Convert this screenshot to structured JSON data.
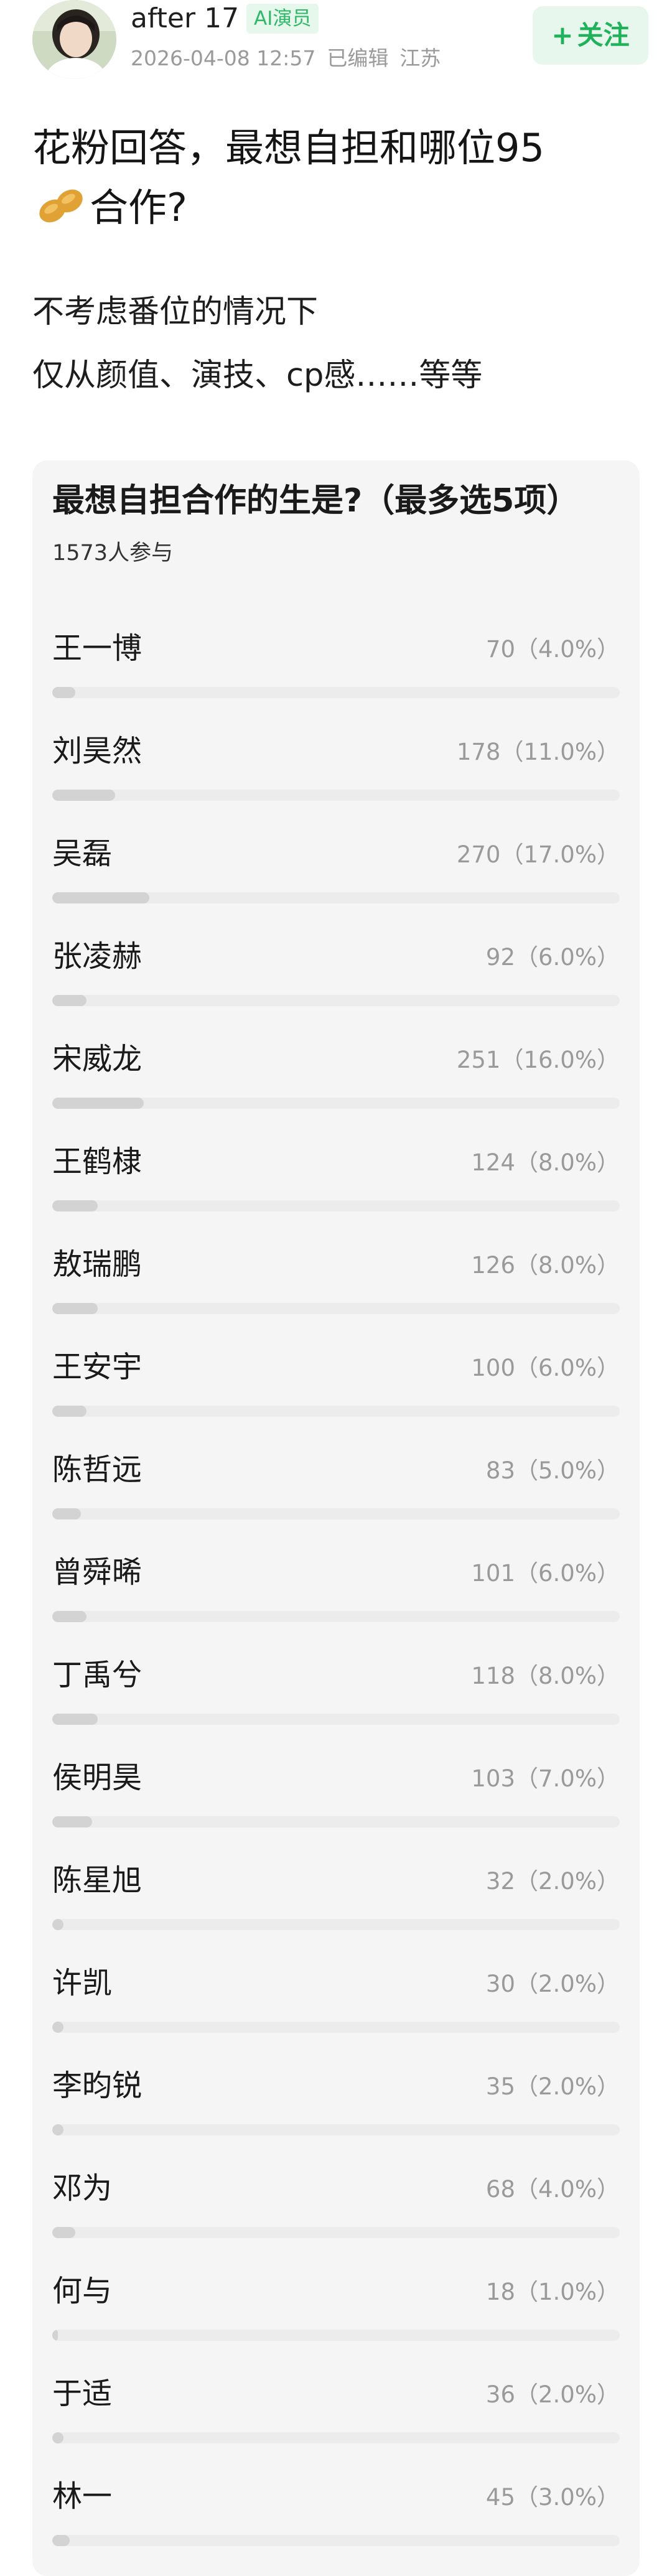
{
  "post": {
    "author": {
      "name": "after 17",
      "badge": "AI演员",
      "timestamp": "2026-04-08 12:57",
      "edited": "已编辑",
      "location": "江苏"
    },
    "follow_label": "关注",
    "title_line1": "花粉回答，最想自担和哪位95",
    "title_line2": "合作?",
    "body_lines": [
      "不考虑番位的情况下",
      "仅从颜值、演技、cp感……等等"
    ]
  },
  "poll": {
    "title": "最想自担合作的生是?（最多选5项）",
    "participants": "1573人参与",
    "options": [
      {
        "name": "王一博",
        "count": "70（4.0%）",
        "fraction": 0.04
      },
      {
        "name": "刘昊然",
        "count": "178（11.0%）",
        "fraction": 0.11
      },
      {
        "name": "吴磊",
        "count": "270（17.0%）",
        "fraction": 0.17
      },
      {
        "name": "张凌赫",
        "count": "92（6.0%）",
        "fraction": 0.06
      },
      {
        "name": "宋威龙",
        "count": "251（16.0%）",
        "fraction": 0.16
      },
      {
        "name": "王鹤棣",
        "count": "124（8.0%）",
        "fraction": 0.08
      },
      {
        "name": "敖瑞鹏",
        "count": "126（8.0%）",
        "fraction": 0.08
      },
      {
        "name": "王安宇",
        "count": "100（6.0%）",
        "fraction": 0.06
      },
      {
        "name": "陈哲远",
        "count": "83（5.0%）",
        "fraction": 0.05
      },
      {
        "name": "曾舜晞",
        "count": "101（6.0%）",
        "fraction": 0.06
      },
      {
        "name": "丁禹兮",
        "count": "118（8.0%）",
        "fraction": 0.08
      },
      {
        "name": "侯明昊",
        "count": "103（7.0%）",
        "fraction": 0.07
      },
      {
        "name": "陈星旭",
        "count": "32（2.0%）",
        "fraction": 0.02
      },
      {
        "name": "许凯",
        "count": "30（2.0%）",
        "fraction": 0.02
      },
      {
        "name": "李昀锐",
        "count": "35（2.0%）",
        "fraction": 0.02
      },
      {
        "name": "邓为",
        "count": "68（4.0%）",
        "fraction": 0.04
      },
      {
        "name": "何与",
        "count": "18（1.0%）",
        "fraction": 0.01
      },
      {
        "name": "于适",
        "count": "36（2.0%）",
        "fraction": 0.02
      },
      {
        "name": "林一",
        "count": "45（3.0%）",
        "fraction": 0.03
      }
    ]
  },
  "icons": {
    "avatar": "user-avatar-photo",
    "peanut": "peanut-emoji",
    "follow": "plus-icon"
  },
  "colors": {
    "accent": "#1fb25a",
    "badge_bg": "#e6f7ec",
    "poll_bg": "#f5f5f5",
    "bar_fill": "#d3d3d3",
    "bar_track": "#ececec"
  }
}
